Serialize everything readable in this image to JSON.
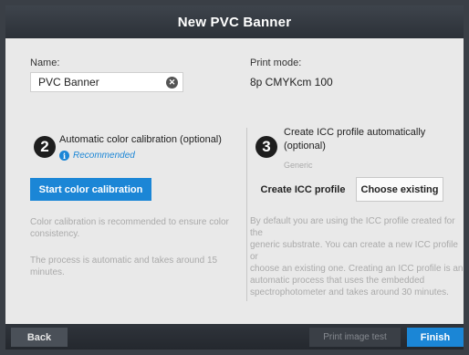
{
  "window": {
    "title": "New PVC Banner"
  },
  "name_field": {
    "label": "Name:",
    "value": "PVC Banner",
    "clear_glyph": "✕"
  },
  "print_mode": {
    "label": "Print mode:",
    "value": "8p CMYKcm 100"
  },
  "step2": {
    "number": "2",
    "title": "Automatic color calibration (optional)",
    "recommended_icon": "info-icon",
    "recommended_glyph": "i",
    "recommended": "Recommended",
    "button": "Start color calibration",
    "text1_line1": "Color calibration is recommended to ensure color",
    "text1_line2": "consistency.",
    "text2_line1": "The process is automatic and takes around 15",
    "text2_line2": "minutes."
  },
  "step3": {
    "number": "3",
    "title_line1": "Create ICC profile automatically",
    "title_line2": "(optional)",
    "subtitle": "Generic",
    "create_button": "Create ICC profile",
    "choose_button": "Choose existing",
    "text_lines": [
      "By default you are using the ICC profile created for the",
      "generic substrate. You can create a new ICC profile or",
      "choose an existing one. Creating an ICC profile is an",
      "automatic process that uses the embedded",
      "spectrophotometer and takes around 30 minutes."
    ]
  },
  "footer": {
    "back": "Back",
    "print_test": "Print image test",
    "finish": "Finish"
  },
  "colors": {
    "accent": "#1b86d6",
    "titlebar": "#2c3138",
    "content_bg": "#e9e9e9"
  }
}
